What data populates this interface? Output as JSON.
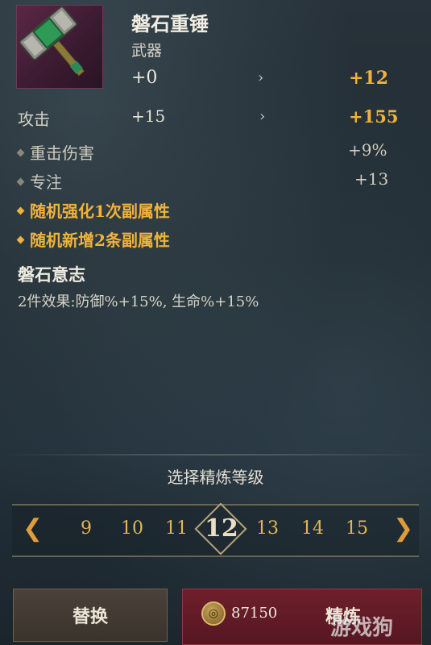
{
  "item": {
    "name": "磐石重锤",
    "type": "武器",
    "level_current": "+0",
    "level_next": "+12",
    "arrow": "›"
  },
  "stats": {
    "attack_label": "攻击",
    "attack_current": "+15",
    "attack_next": "+155",
    "sub": [
      {
        "label": "重击伤害",
        "value": "+9%"
      },
      {
        "label": "专注",
        "value": "+13"
      }
    ],
    "bonuses": [
      "随机强化1次副属性",
      "随机新增2条副属性"
    ]
  },
  "set": {
    "name": "磐石意志",
    "effect": "2件效果:防御%+15%, 生命%+15%"
  },
  "refine": {
    "title": "选择精炼等级",
    "levels": [
      "9",
      "10",
      "11",
      "12",
      "13",
      "14",
      "15"
    ],
    "selected": "12",
    "prev_icon": "chevron-left-icon",
    "next_icon": "chevron-right-icon"
  },
  "buttons": {
    "replace": "替换",
    "refine": "精炼",
    "cost": "87150"
  },
  "watermark": "游戏狗",
  "colors": {
    "gold": "#f0b23a",
    "refine_button": "#6e1f2a",
    "item_bg": "#5a2745"
  }
}
